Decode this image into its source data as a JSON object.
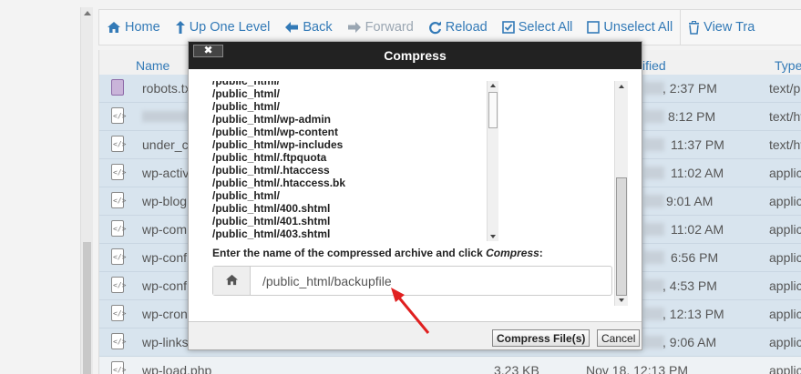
{
  "toolbar": {
    "home": "Home",
    "up_one_level": "Up One Level",
    "back": "Back",
    "forward": "Forward",
    "reload": "Reload",
    "select_all": "Select All",
    "unselect_all": "Unselect All",
    "view_trash": "View Tra"
  },
  "table": {
    "headers": {
      "name": "Name",
      "modified": "ified",
      "type": "Type"
    },
    "rows": [
      {
        "name": "robots.tx",
        "date": ", 2:37 PM",
        "type": "text/plai"
      },
      {
        "name": "",
        "date": "8:12 PM",
        "type": "text/ht"
      },
      {
        "name": "under_c",
        "date": "11:37 PM",
        "type": "text/ht"
      },
      {
        "name": "wp-activ",
        "date": "11:02 AM",
        "type": "applic"
      },
      {
        "name": "wp-blog",
        "date": "9:01 AM",
        "type": "applic"
      },
      {
        "name": "wp-com",
        "date": "11:02 AM",
        "type": "applic"
      },
      {
        "name": "wp-conf",
        "date": "6:56 PM",
        "type": "applic"
      },
      {
        "name": "wp-conf",
        "date": ", 4:53 PM",
        "type": "applic"
      },
      {
        "name": "wp-cron",
        "date": ", 12:13 PM",
        "type": "applic"
      },
      {
        "name": "wp-links",
        "date": ", 9:06 AM",
        "type": "applic"
      },
      {
        "name": "wp-load.php",
        "size": "3.23 KB",
        "date": "Nov 18, 12:13 PM",
        "type": "applic"
      }
    ]
  },
  "modal": {
    "title": "Compress",
    "close_label": "✖",
    "file_list": [
      "/public_html/wp-admin",
      "/public_html/wp-content",
      "/public_html/wp-includes",
      "/public_html/.ftpquota",
      "/public_html/.htaccess",
      "/public_html/.htaccess.bk",
      "/public_html/",
      "/public_html/400.shtml",
      "/public_html/401.shtml",
      "/public_html/403.shtml"
    ],
    "file_list_top": [
      "/public_html/",
      "/public_html/"
    ],
    "instruction_prefix": "Enter the name of the compressed archive and click ",
    "instruction_emphasis": "Compress",
    "instruction_suffix": ":",
    "archive_name": "/public_html/backupfile",
    "compress_button": "Compress File(s)",
    "cancel_button": "Cancel"
  },
  "colors": {
    "accent": "#337ab7",
    "row_selected": "#d8e4ee",
    "annotation_arrow": "#e02020"
  }
}
